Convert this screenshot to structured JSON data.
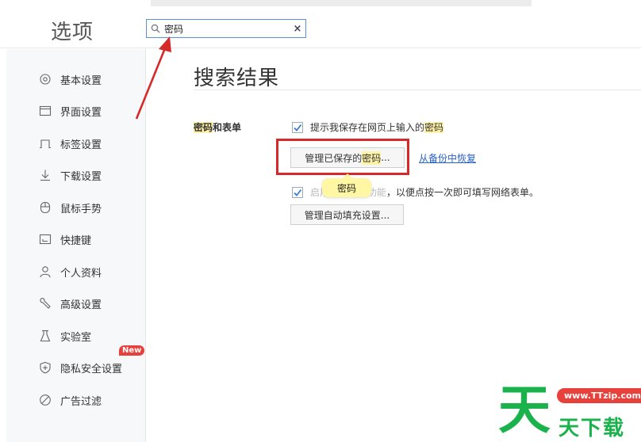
{
  "window": {
    "title": "选项"
  },
  "search": {
    "value": "密码",
    "placeholder": ""
  },
  "sidebar": {
    "items": [
      {
        "label": "基本设置",
        "icon": "gear-icon"
      },
      {
        "label": "界面设置",
        "icon": "window-icon"
      },
      {
        "label": "标签设置",
        "icon": "tab-icon"
      },
      {
        "label": "下载设置",
        "icon": "download-icon"
      },
      {
        "label": "鼠标手势",
        "icon": "mouse-icon"
      },
      {
        "label": "快捷键",
        "icon": "keyboard-icon"
      },
      {
        "label": "个人资料",
        "icon": "user-icon"
      },
      {
        "label": "高级设置",
        "icon": "wrench-icon"
      },
      {
        "label": "实验室",
        "icon": "flask-icon"
      },
      {
        "label": "隐私安全设置",
        "icon": "shield-icon"
      },
      {
        "label": "广告过滤",
        "icon": "block-icon"
      }
    ],
    "new_badge": "New"
  },
  "content": {
    "title": "搜索结果",
    "section_label_highlight": "密码",
    "section_label_rest": "和表单",
    "option1": {
      "text_prefix": "提示我保存在网页上输入的",
      "text_highlight": "密码",
      "checked": true
    },
    "manage_saved_btn": {
      "prefix": "管理已保存的",
      "highlight": "密码",
      "suffix": "..."
    },
    "restore_link": "从备份中恢复",
    "tooltip": "密码",
    "option2": {
      "text_faded": "启用自动填充功能",
      "text_visible": "，以便点按一次即可填写网络表单。",
      "checked": true
    },
    "manage_autofill_btn": "管理自动填充设置..."
  },
  "watermark": {
    "glyph": "天",
    "url": "www.TTzip.com",
    "text": "天下载"
  },
  "colors": {
    "accent_red": "#d62a2a",
    "link_blue": "#2a62c8",
    "highlight": "#fff3a8",
    "watermark_green": "#19b24b",
    "badge_red": "#e8403a"
  }
}
